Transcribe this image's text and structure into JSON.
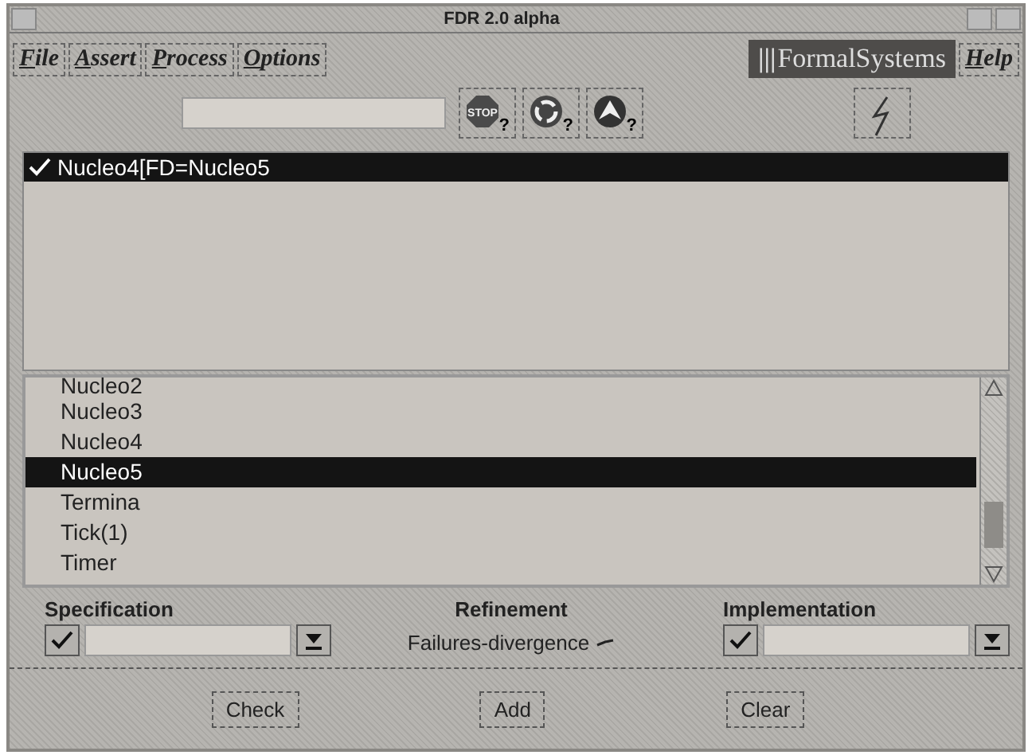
{
  "window": {
    "title": "FDR 2.0 alpha"
  },
  "menu": [
    {
      "label": "File"
    },
    {
      "label": "Assert"
    },
    {
      "label": "Process"
    },
    {
      "label": "Options"
    }
  ],
  "brand": {
    "mark": "|||",
    "name": "FormalSystems"
  },
  "help": {
    "label": "Help"
  },
  "toolbar": {
    "tools": [
      {
        "kind": "stop",
        "label": "STOP",
        "badge": "?"
      },
      {
        "kind": "cycle",
        "badge": "?"
      },
      {
        "kind": "up",
        "badge": "?"
      }
    ]
  },
  "assertions": [
    {
      "text": "Nucleo4[FD=Nucleo5",
      "checked": true,
      "selected": true
    }
  ],
  "processes": [
    {
      "name": "Nucleo2",
      "selected": false
    },
    {
      "name": "Nucleo3",
      "selected": false
    },
    {
      "name": "Nucleo4",
      "selected": false
    },
    {
      "name": "Nucleo5",
      "selected": true
    },
    {
      "name": "Termina",
      "selected": false
    },
    {
      "name": "Tick(1)",
      "selected": false
    },
    {
      "name": "Timer",
      "selected": false
    }
  ],
  "specification": {
    "label": "Specification",
    "checked": true
  },
  "refinement": {
    "label": "Refinement",
    "value": "Failures-divergence"
  },
  "implementation": {
    "label": "Implementation",
    "checked": true
  },
  "buttons": [
    "Check",
    "Add",
    "Clear"
  ]
}
